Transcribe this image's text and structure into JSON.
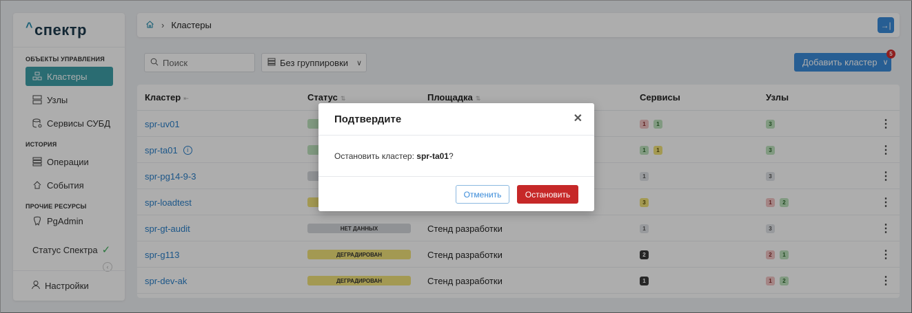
{
  "sidebar": {
    "logo": "спектр",
    "sections": [
      {
        "title": "ОБЪЕКТЫ УПРАВЛЕНИЯ"
      },
      {
        "title": "ИСТОРИЯ"
      },
      {
        "title": "ПРОЧИЕ РЕСУРСЫ"
      }
    ],
    "items": [
      {
        "label": "Кластеры",
        "icon": "cluster-icon",
        "active": true
      },
      {
        "label": "Узлы",
        "icon": "server-icon"
      },
      {
        "label": "Сервисы СУБД",
        "icon": "database-icon"
      },
      {
        "label": "Операции",
        "icon": "operations-icon"
      },
      {
        "label": "События",
        "icon": "events-icon"
      },
      {
        "label": "PgAdmin",
        "icon": "pgadmin-icon"
      }
    ],
    "status_label": "Статус Спектра",
    "settings_label": "Настройки"
  },
  "breadcrumb": {
    "current": "Кластеры"
  },
  "toolbar": {
    "search_placeholder": "Поиск",
    "grouping_label": "Без группировки",
    "add_label": "Добавить кластер",
    "notification_count": "5"
  },
  "table": {
    "headers": {
      "cluster": "Кластер",
      "status": "Статус",
      "site": "Площадка",
      "services": "Сервисы",
      "nodes": "Узлы"
    },
    "rows": [
      {
        "name": "spr-uv01",
        "status": "",
        "status_color": "#bfe3bf",
        "site": "",
        "services": [
          [
            "1",
            "red"
          ],
          [
            "1",
            "green"
          ]
        ],
        "nodes": [
          [
            "3",
            "green"
          ]
        ]
      },
      {
        "name": "spr-ta01",
        "info": true,
        "status": "",
        "status_color": "#bfe3bf",
        "site": "",
        "services": [
          [
            "1",
            "green"
          ],
          [
            "1",
            "yellow"
          ]
        ],
        "nodes": [
          [
            "3",
            "green"
          ]
        ]
      },
      {
        "name": "spr-pg14-9-3",
        "status": "",
        "status_color": "#d5d7dc",
        "site": "",
        "services": [
          [
            "1",
            "gray"
          ]
        ],
        "nodes": [
          [
            "3",
            "gray"
          ]
        ]
      },
      {
        "name": "spr-loadtest",
        "status": "",
        "status_color": "#f0e27a",
        "site": "",
        "services": [
          [
            "3",
            "yellow"
          ]
        ],
        "nodes": [
          [
            "1",
            "red"
          ],
          [
            "2",
            "green"
          ]
        ]
      },
      {
        "name": "spr-gt-audit",
        "status": "НЕТ ДАННЫХ",
        "status_color": "#d5d7dc",
        "site": "Стенд разработки",
        "services": [
          [
            "1",
            "gray"
          ]
        ],
        "nodes": [
          [
            "3",
            "gray"
          ]
        ]
      },
      {
        "name": "spr-g113",
        "status": "ДЕГРАДИРОВАН",
        "status_color": "#f0e27a",
        "site": "Стенд разработки",
        "services": [
          [
            "2",
            "dark"
          ]
        ],
        "nodes": [
          [
            "2",
            "red"
          ],
          [
            "1",
            "green"
          ]
        ]
      },
      {
        "name": "spr-dev-ak",
        "status": "ДЕГРАДИРОВАН",
        "status_color": "#f0e27a",
        "site": "Стенд разработки",
        "services": [
          [
            "1",
            "dark"
          ]
        ],
        "nodes": [
          [
            "1",
            "red"
          ],
          [
            "2",
            "green"
          ]
        ]
      }
    ]
  },
  "modal": {
    "title": "Подтвердите",
    "message_prefix": "Остановить кластер: ",
    "cluster_name": "spr-ta01",
    "message_suffix": "?",
    "cancel_label": "Отменить",
    "confirm_label": "Остановить"
  },
  "colors": {
    "accent": "#3a8bd9",
    "danger": "#c62828",
    "active_nav": "#3fa0a8"
  }
}
